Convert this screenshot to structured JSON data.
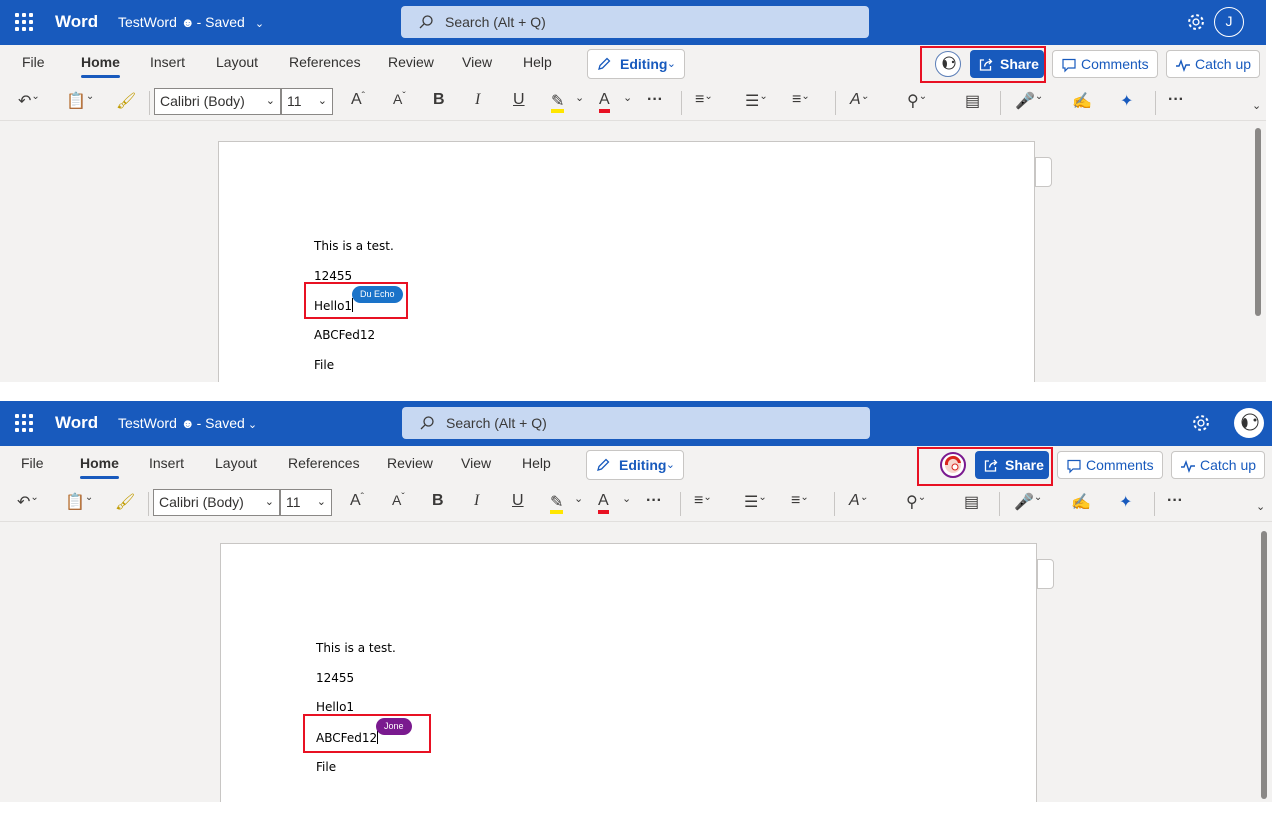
{
  "app": {
    "name": "Word",
    "doc_title": "TestWord",
    "saved_status": "- Saved"
  },
  "search": {
    "placeholder": "Search (Alt + Q)"
  },
  "menu": {
    "file": "File",
    "home": "Home",
    "insert": "Insert",
    "layout": "Layout",
    "references": "References",
    "review": "Review",
    "view": "View",
    "help": "Help",
    "editing": "Editing"
  },
  "actions": {
    "share": "Share",
    "comments": "Comments",
    "catchup": "Catch up"
  },
  "font": {
    "name": "Calibri (Body)",
    "size": "11"
  },
  "ribbon": {
    "bold": "B",
    "italic": "I",
    "underline": "U",
    "font_color": "A",
    "more": "···",
    "more_right": "···"
  },
  "user_initial": "J",
  "document_lines": [
    "This is a test.",
    "12455",
    "Hello1",
    "ABCFed12",
    "File"
  ],
  "panes": [
    {
      "presence_name": "Du Echo",
      "presence_color": "#1a73c9",
      "cursor_line": 2
    },
    {
      "presence_name": "Jone",
      "presence_color": "#7a1a8f",
      "cursor_line": 3
    }
  ],
  "colors": {
    "brand": "#185abd",
    "highlight": "#e81123"
  }
}
